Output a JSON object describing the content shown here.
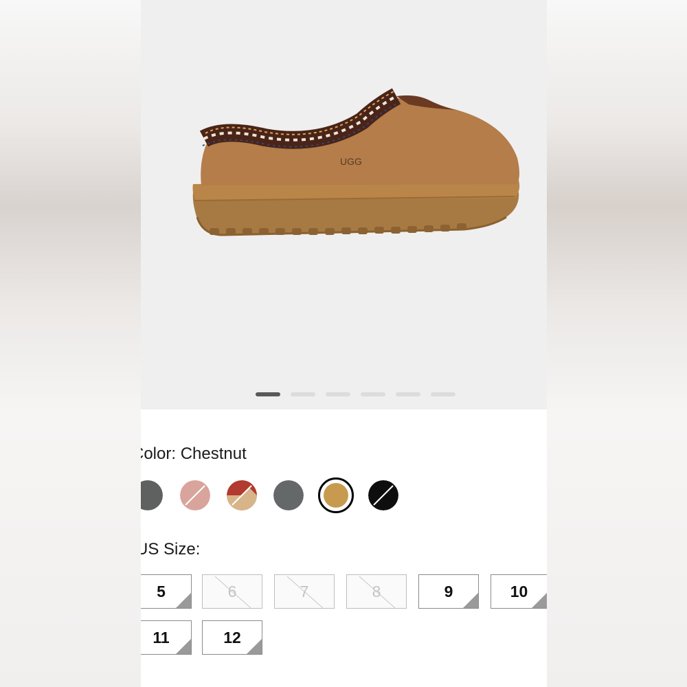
{
  "product": {
    "name_icon": "ugg-logo-icon",
    "carousel": {
      "count": 6,
      "active_index": 0
    }
  },
  "color": {
    "label": "Color: Chestnut",
    "swatches": [
      {
        "name": "grey-dark",
        "color": "#5f6060",
        "available": true
      },
      {
        "name": "pink",
        "color": "#d9a49b",
        "available": false
      },
      {
        "name": "red-tan",
        "color": "#b23a2f",
        "color2": "#d8b489",
        "available": false
      },
      {
        "name": "charcoal",
        "color": "#656869",
        "available": true
      },
      {
        "name": "chestnut",
        "color": "#c79a4f",
        "available": true,
        "selected": true
      },
      {
        "name": "black",
        "color": "#0e0e0e",
        "available": false
      }
    ]
  },
  "size": {
    "label": "US Size:",
    "options": [
      {
        "label": "5",
        "available": true
      },
      {
        "label": "6",
        "available": false
      },
      {
        "label": "7",
        "available": false
      },
      {
        "label": "8",
        "available": false
      },
      {
        "label": "9",
        "available": true
      },
      {
        "label": "10",
        "available": true
      },
      {
        "label": "11",
        "available": true
      },
      {
        "label": "12",
        "available": true
      }
    ]
  }
}
